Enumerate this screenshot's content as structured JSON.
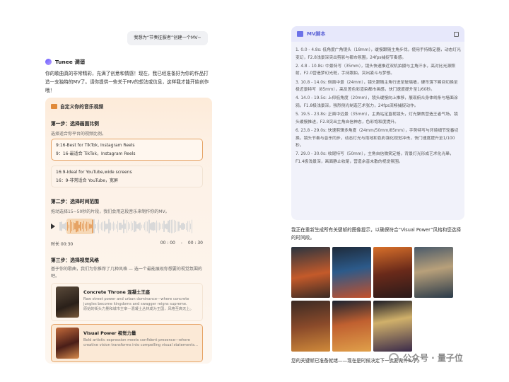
{
  "left": {
    "user_message": "我想为“节奏征服者”创建一个MV~",
    "assistant_name": "Tunee 调谐",
    "intro": "你的歌曲真的非常精彩，充满了创意和情感！现在，我已经准备好为你的作品打造一支独特的MV了。请你提供一些关于MV的想法或信息，这样我才能开始创作哦！",
    "card_title": "自定义你的音乐视频",
    "step1": {
      "title": "第一步：选择画面比例",
      "hint": "选择适合你平台的视频比例。",
      "options": [
        {
          "line1": "9:16-Best for TikTok, Instagram Reels",
          "line2": "9：16-最适合 TikTok，Instagram Reels",
          "selected": true
        },
        {
          "line1": "16:9-Ideal for YouTube,wide screens",
          "line2": "16：9-非常适合 YouTube，宽屏",
          "selected": false
        }
      ]
    },
    "step2": {
      "title": "第二步：选择时间范围",
      "hint": "拖动选择15~50秒的片段，我们会用这段音乐来制作你的MV。",
      "duration_label": "时长 00:30",
      "start_time": "00 : 00",
      "separator": "-",
      "end_time": "00 : 30"
    },
    "step3": {
      "title": "第三步：选择视觉风格",
      "hint": "基于你的歌曲，我们为你推荐了几种风格 — 选一个最能展现你想要的视觉氛围的吧。",
      "styles": [
        {
          "title": "Concrete Throne 混凝土王座",
          "desc_en": "Raw street power and urban dominance—where concrete jungles become kingdoms and swagger reigns supreme.",
          "desc_zh": "原始的街头力量和城市主宰—混凝土丛林成为王国，风格至高无上。",
          "selected": false
        },
        {
          "title": "Visual Power 视觉力量",
          "desc_en": "Bold artistic expression meets confident presence—where creative vision transforms into compelling visual statements...",
          "desc_zh": "",
          "selected": true
        }
      ]
    }
  },
  "right": {
    "panel_title": "MV脚本",
    "script": [
      "1. 0.0 - 4.8s: 低角度广角镜头（18mm），缓慢跟随主角步伐，使用手持稳定器，动态灯光变幻，F2.8浅景深突出剪影与都市氛围，24fps捕捉节奏感。",
      "2. 4.8 - 10.8s: 中景特写（35mm），镜头快速推近双机拍摄与主角汗水，高对比光源照射，F2.0营造梦幻光斑，手持跟拍，突出紧斗与梦想。",
      "3. 10.8 - 14.0s: 侧面中景（24mm），镜头跟随主角行进至玻璃墙，硬币落下瞬间切换至极近景特写（85mm），高反差色彩渲染都市画感，快门速度提升至1/60秒。",
      "4. 14.0 - 19.5s: 上仰低角度（20mm），镜头缓慢向上推移，展现俯众身体线条与墙面涂鸦，F1.8极浅景深，强烈侧光制造艺术张力，24fps流畅捕捉动作。",
      "5. 19.5 - 23.8s: 正面中远景（35mm），主角站定直视镜头，灯光聚焦营造王者气场，镜头缓慢推进，F2.8突出主角自信神态，色彩饱和度提升。",
      "6. 23.8 - 29.0s: 快速剪辑多角度（24mm/50mm/85mm），手势特写与环境细节轮番切换，镜头节奏与音乐同步，动态灯光与雨地和色彩强化视觉冲击，快门速度提升至1/100秒。",
      "7. 29.0 - 30.0s: 收尾特写（50mm），主角自信微笑定格，背景灯光形成艺术化光晕，F1.4极浅景深，画面静止收尾，营造余音未散的视觉氛围。"
    ],
    "regen_text": "我正在重新生成所有关键帧的图像提示，以确保符合“Visual Power”风格和您选择的时间段。",
    "footer_text": "您的关键帧已准备就绪——现在是时候决定下一步要做什么了。",
    "watermark": "公众号 · 量子位"
  },
  "colors": {
    "accent_orange": "#e6a365",
    "accent_purple": "#5c63d6",
    "card_bg": "#fdf1e6"
  }
}
